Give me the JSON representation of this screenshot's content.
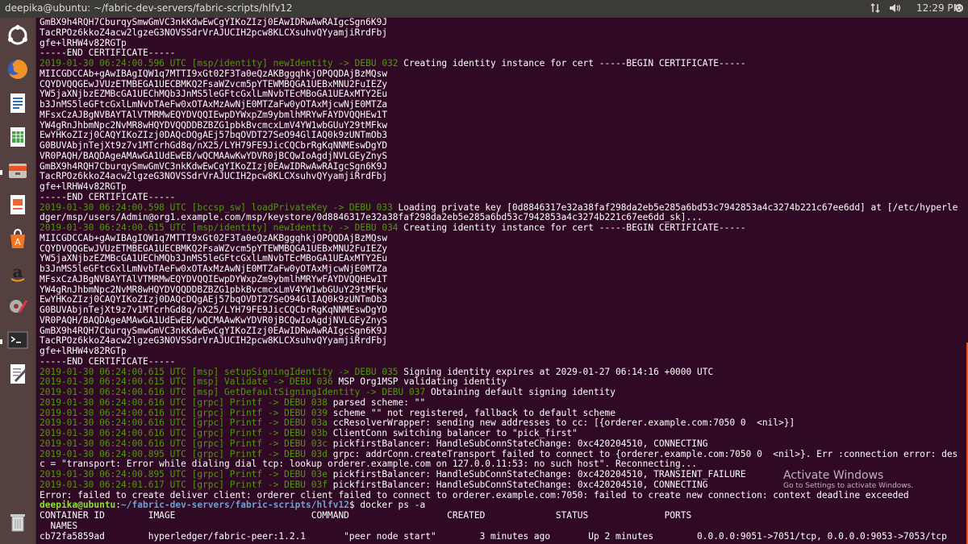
{
  "topbar": {
    "title": "deepika@ubuntu: ~/fabric-dev-servers/fabric-scripts/hlfv12",
    "time": "12:29 PM"
  },
  "launcher": {
    "items": [
      {
        "name": "dash-icon",
        "bg": "#e95420"
      },
      {
        "name": "firefox-icon",
        "bg": "#7a3b2a"
      },
      {
        "name": "libreoffice-writer-icon",
        "bg": "#2a5a8c"
      },
      {
        "name": "libreoffice-calc-icon",
        "bg": "#2e7d32"
      },
      {
        "name": "files-icon",
        "bg": "#6b5b53"
      },
      {
        "name": "libreoffice-impress-icon",
        "bg": "#c0572b"
      },
      {
        "name": "software-center-icon",
        "bg": "#e95420"
      },
      {
        "name": "amazon-icon",
        "bg": "#c7c0b8"
      },
      {
        "name": "system-settings-icon",
        "bg": "#8a3a30"
      },
      {
        "name": "terminal-icon",
        "bg": "#333333"
      },
      {
        "name": "text-editor-icon",
        "bg": "#d8d4cc"
      },
      {
        "name": "trash-icon",
        "bg": "#6b5b53"
      }
    ]
  },
  "terminal": {
    "lines": [
      [
        {
          "t": "GmBX9h4RQH7CburqySmwGmVC3nkKdwEwCgYIKoZIzj0EAwIDRwAwRAIgcSgn6K9J"
        }
      ],
      [
        {
          "t": "TacRPOz6kkoZ4acw2lgzeG3NOVSSdrVrAJUCIH2pcw8KLCXsuhvQYyamjiRrdFbj"
        }
      ],
      [
        {
          "t": "gfe+lRHW4v82RGTp"
        }
      ],
      [
        {
          "t": "-----END CERTIFICATE-----"
        }
      ],
      [
        {
          "t": "2019-01-30 06:24:00.596 UTC [msp/identity] newIdentity -> DEBU 032",
          "c": "c"
        },
        {
          "t": " Creating identity instance for cert -----BEGIN CERTIFICATE-----"
        }
      ],
      [
        {
          "t": "MIICGDCCAb+gAwIBAgIQW1q7MTTI9xGt02F3Ta0eQzAKBggqhkjOPQQDAjBzMQsw"
        }
      ],
      [
        {
          "t": "CQYDVQQGEwJVUzETMBEGA1UECBMKQ2FsaWZvcm5pYTEWMBQGA1UEBxMNU2FuIEZy"
        }
      ],
      [
        {
          "t": "YW5jaXNjbzEZMBcGA1UEChMQb3JnMS5leGFtcGxlLmNvbTEcMBoGA1UEAxMTY2Eu"
        }
      ],
      [
        {
          "t": "b3JnMS5leGFtcGxlLmNvbTAeFw0xOTAxMzAwNjE0MTZaFw0yOTAxMjcwNjE0MTZa"
        }
      ],
      [
        {
          "t": "MFsxCzAJBgNVBAYTAlVTMRMwEQYDVQQIEwpDYWxpZm9ybmlhMRYwFAYDVQQHEw1T"
        }
      ],
      [
        {
          "t": "YW4gRnJhbmNpc2NvMR8wHQYDVQQDDBZBZG1pbkBvcmcxLmV4YW1wbGUuY29tMFkw"
        }
      ],
      [
        {
          "t": "EwYHKoZIzj0CAQYIKoZIzj0DAQcDQgAEj57bqOVDT27SeO94GlIAQ0k9zUNTmOb3"
        }
      ],
      [
        {
          "t": "G0BUVAbjnTejXt9z7v1MTcrhGd8q/nX25/LYH79FE9JicCQCbrRgKqNNMEswDgYD"
        }
      ],
      [
        {
          "t": "VR0PAQH/BAQDAgeAMAwGA1UdEwEB/wQCMAAwKwYDVR0jBCQwIoAgdjNVLGEyZnyS"
        }
      ],
      [
        {
          "t": "GmBX9h4RQH7CburqySmwGmVC3nkKdwEwCgYIKoZIzj0EAwIDRwAwRAIgcSgn6K9J"
        }
      ],
      [
        {
          "t": "TacRPOz6kkoZ4acw2lgzeG3NOVSSdrVrAJUCIH2pcw8KLCXsuhvQYyamjiRrdFbj"
        }
      ],
      [
        {
          "t": "gfe+lRHW4v82RGTp"
        }
      ],
      [
        {
          "t": "-----END CERTIFICATE-----"
        }
      ],
      [
        {
          "t": "2019-01-30 06:24:00.598 UTC [bccsp_sw] loadPrivateKey -> DEBU 033",
          "c": "c"
        },
        {
          "t": " Loading private key [0d8846317e32a38faf298da2eb5e285a6bd53c7942853a4c3274b221c67ee6dd] at [/etc/hyperle"
        }
      ],
      [
        {
          "t": "dger/msp/users/Admin@org1.example.com/msp/keystore/0d8846317e32a38faf298da2eb5e285a6bd53c7942853a4c3274b221c67ee6dd_sk]..."
        }
      ],
      [
        {
          "t": "2019-01-30 06:24:00.615 UTC [msp/identity] newIdentity -> DEBU 034",
          "c": "c"
        },
        {
          "t": " Creating identity instance for cert -----BEGIN CERTIFICATE-----"
        }
      ],
      [
        {
          "t": "MIICGDCCAb+gAwIBAgIQW1q7MTTI9xGt02F3Ta0eQzAKBggqhkjOPQQDAjBzMQsw"
        }
      ],
      [
        {
          "t": "CQYDVQQGEwJVUzETMBEGA1UECBMKQ2FsaWZvcm5pYTEWMBQGA1UEBxMNU2FuIEZy"
        }
      ],
      [
        {
          "t": "YW5jaXNjbzEZMBcGA1UEChMQb3JnMS5leGFtcGxlLmNvbTEcMBoGA1UEAxMTY2Eu"
        }
      ],
      [
        {
          "t": "b3JnMS5leGFtcGxlLmNvbTAeFw0xOTAxMzAwNjE0MTZaFw0yOTAxMjcwNjE0MTZa"
        }
      ],
      [
        {
          "t": "MFsxCzAJBgNVBAYTAlVTMRMwEQYDVQQIEwpDYWxpZm9ybmlhMRYwFAYDVQQHEw1T"
        }
      ],
      [
        {
          "t": "YW4gRnJhbmNpc2NvMR8wHQYDVQQDDBZBZG1pbkBvcmcxLmV4YW1wbGUuY29tMFkw"
        }
      ],
      [
        {
          "t": "EwYHKoZIzj0CAQYIKoZIzj0DAQcDQgAEj57bqOVDT27SeO94GlIAQ0k9zUNTmOb3"
        }
      ],
      [
        {
          "t": "G0BUVAbjnTejXt9z7v1MTcrhGd8q/nX25/LYH79FE9JicCQCbrRgKqNNMEswDgYD"
        }
      ],
      [
        {
          "t": "VR0PAQH/BAQDAgeAMAwGA1UdEwEB/wQCMAAwKwYDVR0jBCQwIoAgdjNVLGEyZnyS"
        }
      ],
      [
        {
          "t": "GmBX9h4RQH7CburqySmwGmVC3nkKdwEwCgYIKoZIzj0EAwIDRwAwRAIgcSgn6K9J"
        }
      ],
      [
        {
          "t": "TacRPOz6kkoZ4acw2lgzeG3NOVSSdrVrAJUCIH2pcw8KLCXsuhvQYyamjiRrdFbj"
        }
      ],
      [
        {
          "t": "gfe+lRHW4v82RGTp"
        }
      ],
      [
        {
          "t": "-----END CERTIFICATE-----"
        }
      ],
      [
        {
          "t": "2019-01-30 06:24:00.615 UTC [msp] setupSigningIdentity -> DEBU 035",
          "c": "c"
        },
        {
          "t": " Signing identity expires at 2029-01-27 06:14:16 +0000 UTC"
        }
      ],
      [
        {
          "t": "2019-01-30 06:24:00.615 UTC [msp] Validate -> DEBU 036",
          "c": "c"
        },
        {
          "t": " MSP Org1MSP validating identity"
        }
      ],
      [
        {
          "t": "2019-01-30 06:24:00.616 UTC [msp] GetDefaultSigningIdentity -> DEBU 037",
          "c": "c"
        },
        {
          "t": " Obtaining default signing identity"
        }
      ],
      [
        {
          "t": "2019-01-30 06:24:00.616 UTC [grpc] Printf -> DEBU 038",
          "c": "c"
        },
        {
          "t": " parsed scheme: \"\""
        }
      ],
      [
        {
          "t": "2019-01-30 06:24:00.616 UTC [grpc] Printf -> DEBU 039",
          "c": "c"
        },
        {
          "t": " scheme \"\" not registered, fallback to default scheme"
        }
      ],
      [
        {
          "t": "2019-01-30 06:24:00.616 UTC [grpc] Printf -> DEBU 03a",
          "c": "c"
        },
        {
          "t": " ccResolverWrapper: sending new addresses to cc: [{orderer.example.com:7050 0  <nil>}]"
        }
      ],
      [
        {
          "t": "2019-01-30 06:24:00.616 UTC [grpc] Printf -> DEBU 03b",
          "c": "c"
        },
        {
          "t": " ClientConn switching balancer to \"pick_first\""
        }
      ],
      [
        {
          "t": "2019-01-30 06:24:00.616 UTC [grpc] Printf -> DEBU 03c",
          "c": "c"
        },
        {
          "t": " pickfirstBalancer: HandleSubConnStateChange: 0xc420204510, CONNECTING"
        }
      ],
      [
        {
          "t": "2019-01-30 06:24:00.895 UTC [grpc] Printf -> DEBU 03d",
          "c": "c"
        },
        {
          "t": " grpc: addrConn.createTransport failed to connect to {orderer.example.com:7050 0  <nil>}. Err :connection error: des"
        }
      ],
      [
        {
          "t": "c = \"transport: Error while dialing dial tcp: lookup orderer.example.com on 127.0.0.11:53: no such host\". Reconnecting..."
        }
      ],
      [
        {
          "t": "2019-01-30 06:24:00.895 UTC [grpc] Printf -> DEBU 03e",
          "c": "c"
        },
        {
          "t": " pickfirstBalancer: HandleSubConnStateChange: 0xc420204510, TRANSIENT_FAILURE"
        }
      ],
      [
        {
          "t": "2019-01-30 06:24:01.617 UTC [grpc] Printf -> DEBU 03f",
          "c": "c"
        },
        {
          "t": " pickfirstBalancer: HandleSubConnStateChange: 0xc420204510, CONNECTING"
        }
      ],
      [
        {
          "t": "Error: failed to create deliver client: orderer client failed to connect to orderer.example.com:7050: failed to create new connection: context deadline exceeded"
        }
      ],
      [
        {
          "t": "deepika@ubuntu",
          "c": "pg"
        },
        {
          "t": ":"
        },
        {
          "t": "~/fabric-dev-servers/fabric-scripts/hlfv12",
          "c": "pb"
        },
        {
          "t": "$ docker ps -a"
        }
      ],
      [
        {
          "t": "CONTAINER ID        IMAGE                         COMMAND                  CREATED             STATUS              PORTS"
        }
      ],
      [
        {
          "t": "  NAMES"
        }
      ],
      [
        {
          "t": "cb72fa5859ad        hyperledger/fabric-peer:1.2.1       \"peer node start\"        3 minutes ago       Up 2 minutes        0.0.0.0:9051->7051/tcp, 0.0.0.0:9053->7053/tcp"
        }
      ]
    ]
  },
  "watermark": {
    "title": "Activate Windows",
    "subtitle": "Go to Settings to activate Windows."
  }
}
